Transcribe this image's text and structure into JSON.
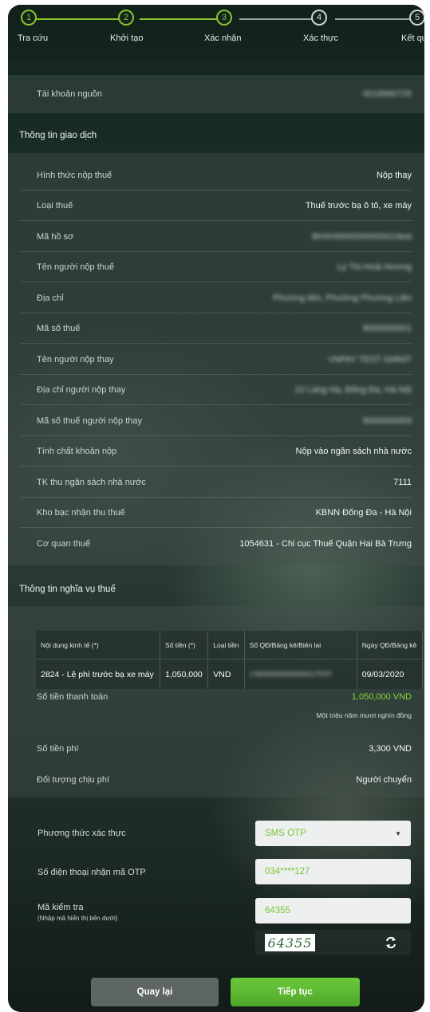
{
  "stepper": {
    "steps": [
      {
        "number": "1",
        "label": "Tra cứu",
        "state": "done"
      },
      {
        "number": "2",
        "label": "Khởi tạo",
        "state": "done"
      },
      {
        "number": "3",
        "label": "Xác nhận",
        "state": "current"
      },
      {
        "number": "4",
        "label": "Xác thực",
        "state": "pending"
      },
      {
        "number": "5",
        "label": "Kết quả",
        "state": "pending"
      }
    ]
  },
  "source_account": {
    "label": "Tài khoản nguồn",
    "value": "0019960725"
  },
  "transaction_info": {
    "title": "Thông tin giao dịch",
    "rows": [
      {
        "label": "Hình thức nộp thuế",
        "value": "Nộp thay"
      },
      {
        "label": "Loại thuế",
        "value": "Thuế trước bạ ô tô, xe máy"
      },
      {
        "label": "Mã hồ sơ",
        "value": "BHXH000000000001/test"
      },
      {
        "label": "Tên người nộp thuế",
        "value": "Lý Thị Hoài Hương"
      },
      {
        "label": "Địa chỉ",
        "value": "Phương liên, Phường Phương Liên"
      },
      {
        "label": "Mã số thuế",
        "value": "8000000001"
      },
      {
        "label": "Tên người nộp thay",
        "value": "VNPAY TEST GMNIT"
      },
      {
        "label": "Địa chỉ người nộp thay",
        "value": "22 Láng Hạ, Đống Đa, Hà Nội"
      },
      {
        "label": "Mã số thuế người nộp thay",
        "value": "9000000003"
      },
      {
        "label": "Tính chất khoản nộp",
        "value": "Nộp vào ngân sách nhà nước"
      },
      {
        "label": "TK thu ngân sách nhà nước",
        "value": "7111"
      },
      {
        "label": "Kho bạc nhận thu thuế",
        "value": "KBNN Đống Đa - Hà Nội"
      },
      {
        "label": "Cơ quan thuế",
        "value": "1054631 - Chi cục Thuế Quận Hai Bà Trưng"
      }
    ]
  },
  "obligation_info": {
    "title": "Thông tin nghĩa vụ thuế",
    "table": {
      "headers": [
        "Nội dung kinh tế (*)",
        "Số tiền (*)",
        "Loại tiền",
        "Số QĐ/Bảng kê/Biên lai",
        "Ngày QĐ/Bảng kê"
      ],
      "rows": [
        [
          "2824 - Lệ phí trước bạ xe máy",
          "1,050,000",
          "VND",
          "LTB000000000000001/TEST",
          "09/03/2020"
        ]
      ]
    },
    "payment_amount": {
      "label": "Số tiền thanh toán",
      "value": "1,050,000 VND",
      "words": "Một triệu năm mươi nghìn đồng"
    },
    "fee": {
      "label": "Số tiền phí",
      "value": "3,300 VND"
    },
    "fee_payer": {
      "label": "Đối tượng chịu phí",
      "value": "Người chuyển"
    }
  },
  "auth_form": {
    "method_label": "Phương thức xác thực",
    "method_value": "SMS OTP",
    "phone_label": "Số điện thoại nhận mã OTP",
    "phone_value": "034****127",
    "captcha_label": "Mã kiểm tra",
    "captcha_hint": "(Nhập mã hiển thị bên dưới)",
    "captcha_value": "64355",
    "captcha_image_text": "64355"
  },
  "buttons": {
    "back": "Quay lại",
    "next": "Tiếp tục"
  },
  "colors": {
    "accent": "#86c42f",
    "button_green": "#5cb82e",
    "button_grey": "#5e6663"
  }
}
